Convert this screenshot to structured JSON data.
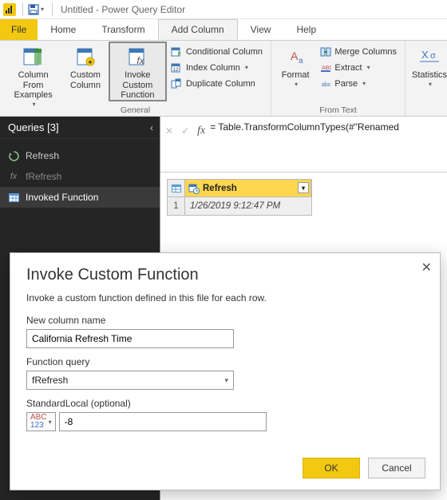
{
  "titlebar": {
    "app_icon_label": "pbi-icon",
    "dropdown_glyph": "▾",
    "title": "Untitled - Power Query Editor"
  },
  "menu": {
    "file": "File",
    "tabs": [
      "Home",
      "Transform",
      "Add Column",
      "View",
      "Help"
    ],
    "active": "Add Column"
  },
  "ribbon": {
    "group_general": {
      "label": "General",
      "col_from_examples": "Column From Examples",
      "custom_column": "Custom Column",
      "invoke_custom": "Invoke Custom Function",
      "cond_col": "Conditional Column",
      "index_col": "Index Column",
      "dup_col": "Duplicate Column"
    },
    "group_text": {
      "label": "From Text",
      "format": "Format",
      "merge": "Merge Columns",
      "extract": "Extract",
      "parse": "Parse"
    },
    "group_stats": {
      "label": "",
      "statistics": "Statistics"
    }
  },
  "queries": {
    "header": "Queries [3]",
    "items": [
      {
        "icon": "refresh-icon",
        "label": "Refresh",
        "active": false
      },
      {
        "icon": "fx-icon",
        "label": "fRefresh",
        "active": false,
        "dim": true
      },
      {
        "icon": "table-icon",
        "label": "Invoked Function",
        "active": true
      }
    ]
  },
  "formula_bar": {
    "formula": "= Table.TransformColumnTypes(#\"Renamed"
  },
  "grid": {
    "col_icon": "datetime-icon",
    "col_name": "Refresh",
    "rows": [
      {
        "num": "1",
        "value": "1/26/2019 9:12:47 PM"
      }
    ]
  },
  "dialog": {
    "title": "Invoke Custom Function",
    "desc": "Invoke a custom function defined in this file for each row.",
    "new_col_label": "New column name",
    "new_col_value": "California Refresh Time",
    "fn_query_label": "Function query",
    "fn_query_value": "fRefresh",
    "param_label": "StandardLocal (optional)",
    "param_type": "ABC 123",
    "param_value": "-8",
    "ok": "OK",
    "cancel": "Cancel"
  }
}
